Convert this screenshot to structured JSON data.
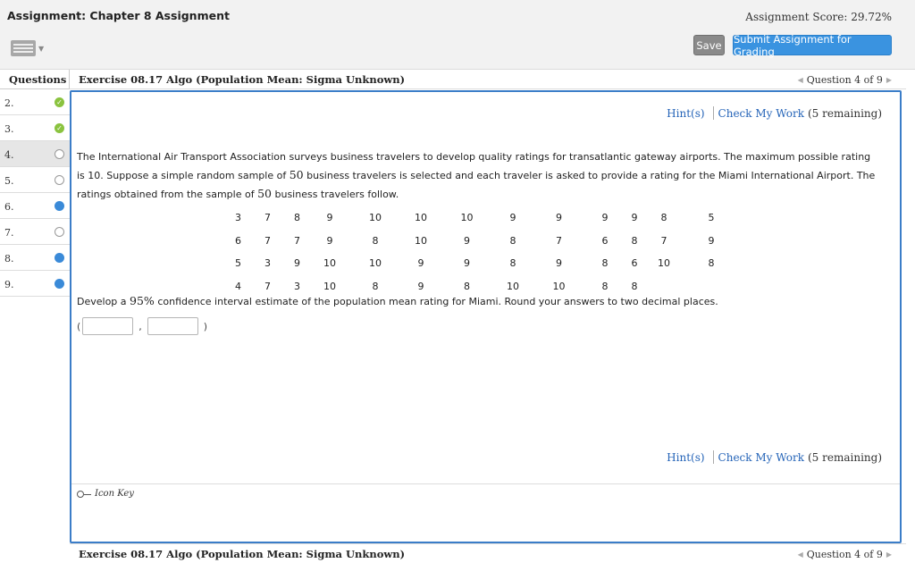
{
  "header": {
    "assignment_title": "Assignment: Chapter 8 Assignment",
    "assignment_score": "Assignment Score: 29.72%",
    "save_label": "Save",
    "submit_label": "Submit Assignment for Grading"
  },
  "sidebar": {
    "heading": "Questions",
    "items": [
      {
        "number": "2.",
        "status": "check"
      },
      {
        "number": "3.",
        "status": "check"
      },
      {
        "number": "4.",
        "status": "empty"
      },
      {
        "number": "5.",
        "status": "empty"
      },
      {
        "number": "6.",
        "status": "partial"
      },
      {
        "number": "7.",
        "status": "empty"
      },
      {
        "number": "8.",
        "status": "partial"
      },
      {
        "number": "9.",
        "status": "partial"
      }
    ]
  },
  "exercise": {
    "title": "Exercise 08.17 Algo (Population Mean: Sigma Unknown)",
    "question_nav": "Question 4 of 9",
    "hints_label": "Hint(s)",
    "check_label": "Check My Work",
    "remaining": "(5 remaining)",
    "problem_part1": "The International Air Transport Association surveys business travelers to develop quality ratings for transatlantic gateway airports. The maximum possible rating is 10. Suppose a simple random sample of ",
    "sample_size": "50",
    "problem_part2": " business travelers is selected and each traveler is asked to provide a rating for the Miami International Airport. The ratings obtained from the sample of ",
    "problem_part3": " business travelers follow.",
    "ratings": [
      [
        "3",
        "7",
        "8",
        "9",
        "10",
        "10",
        "10",
        "9",
        "9",
        "9",
        "9",
        "8",
        "5"
      ],
      [
        "6",
        "7",
        "7",
        "9",
        "8",
        "10",
        "9",
        "8",
        "7",
        "6",
        "8",
        "7",
        "9"
      ],
      [
        "5",
        "3",
        "9",
        "10",
        "10",
        "9",
        "9",
        "8",
        "9",
        "8",
        "6",
        "10",
        "8"
      ],
      [
        "4",
        "7",
        "3",
        "10",
        "8",
        "9",
        "8",
        "10",
        "10",
        "8",
        "8",
        ""
      ]
    ],
    "develop_part1": "Develop a ",
    "confidence": "95%",
    "develop_part2": " confidence interval estimate of the population mean rating for Miami. Round your answers to two decimal places.",
    "open_paren": "(",
    "comma": ",",
    "close_paren": ")",
    "lower_value": "",
    "upper_value": "",
    "icon_key_label": "Icon Key"
  }
}
